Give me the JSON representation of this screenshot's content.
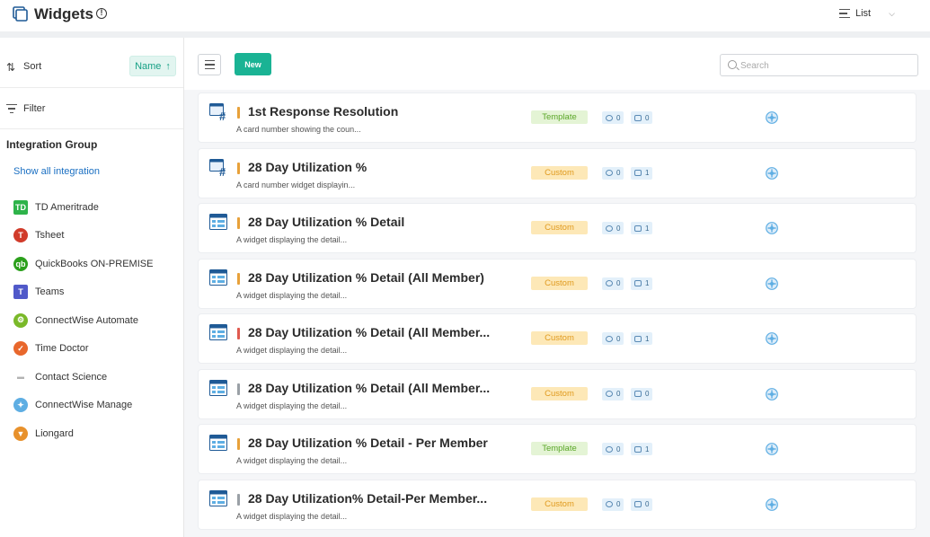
{
  "header": {
    "title": "Widgets",
    "info_glyph": "!",
    "view_label": "List",
    "view_chevron": "⌵"
  },
  "sidebar": {
    "sort_label": "Sort",
    "sort_icon": "⇅",
    "sort_field": "Name",
    "sort_arrow": "↑",
    "filter_label": "Filter",
    "group_title": "Integration Group",
    "show_all": "Show all integration",
    "integrations": [
      {
        "label": "TD Ameritrade",
        "icon": "td-ameritrade-icon",
        "glyph": "TD",
        "color": "#2eb34a",
        "shape": "square"
      },
      {
        "label": "Tsheet",
        "icon": "tsheet-icon",
        "glyph": "T",
        "color": "#d13b2a",
        "shape": "circle"
      },
      {
        "label": "QuickBooks ON-PREMISE",
        "icon": "quickbooks-icon",
        "glyph": "qb",
        "color": "#2ca01c",
        "shape": "circle"
      },
      {
        "label": "Teams",
        "icon": "teams-icon",
        "glyph": "T",
        "color": "#5059c9",
        "shape": "square"
      },
      {
        "label": "ConnectWise Automate",
        "icon": "connectwise-automate-icon",
        "glyph": "⚙",
        "color": "#7ab929",
        "shape": "circle"
      },
      {
        "label": "Time Doctor",
        "icon": "time-doctor-icon",
        "glyph": "✓",
        "color": "#e8672c",
        "shape": "circle"
      },
      {
        "label": "Contact Science",
        "icon": "contact-science-icon",
        "glyph": "▬",
        "color": "#b3b3b3",
        "shape": "square"
      },
      {
        "label": "ConnectWise Manage",
        "icon": "connectwise-manage-icon",
        "glyph": "✦",
        "color": "#5eaee3",
        "shape": "circle"
      },
      {
        "label": "Liongard",
        "icon": "liongard-icon",
        "glyph": "▼",
        "color": "#e8912c",
        "shape": "circle"
      }
    ]
  },
  "toolbar": {
    "new_label": "New",
    "search_placeholder": "Search"
  },
  "colors": {
    "accent": "#1ab394",
    "link": "#1a6fc2",
    "bar_orange": "#e8a13a",
    "bar_red": "#e05a4f",
    "bar_gray": "#9aa0a6"
  },
  "widgets": [
    {
      "title": "1st Response Resolution",
      "desc": "A card number showing the coun...",
      "type": "Template",
      "count1": "0",
      "count2": "0",
      "icon": "card-number-icon",
      "bar": "#e8a13a"
    },
    {
      "title": "28 Day Utilization %",
      "desc": "A card number widget displayin...",
      "type": "Custom",
      "count1": "0",
      "count2": "1",
      "icon": "card-number-icon",
      "bar": "#e8a13a"
    },
    {
      "title": "28 Day Utilization % Detail",
      "desc": "A widget displaying the detail...",
      "type": "Custom",
      "count1": "0",
      "count2": "1",
      "icon": "table-icon",
      "bar": "#e8a13a"
    },
    {
      "title": "28 Day Utilization % Detail (All Member)",
      "desc": "A widget displaying the detail...",
      "type": "Custom",
      "count1": "0",
      "count2": "1",
      "icon": "table-icon",
      "bar": "#e8a13a"
    },
    {
      "title": "28 Day Utilization % Detail (All Member...",
      "desc": "A widget displaying the detail...",
      "type": "Custom",
      "count1": "0",
      "count2": "1",
      "icon": "table-icon",
      "bar": "#e05a4f"
    },
    {
      "title": "28 Day Utilization % Detail (All Member...",
      "desc": "A widget displaying the detail...",
      "type": "Custom",
      "count1": "0",
      "count2": "0",
      "icon": "table-icon",
      "bar": "#9aa0a6"
    },
    {
      "title": "28 Day Utilization % Detail - Per Member",
      "desc": "A widget displaying the detail...",
      "type": "Template",
      "count1": "0",
      "count2": "1",
      "icon": "table-icon",
      "bar": "#e8a13a"
    },
    {
      "title": "28 Day Utilization% Detail-Per Member...",
      "desc": "A widget displaying the detail...",
      "type": "Custom",
      "count1": "0",
      "count2": "0",
      "icon": "table-icon",
      "bar": "#9aa0a6"
    }
  ]
}
